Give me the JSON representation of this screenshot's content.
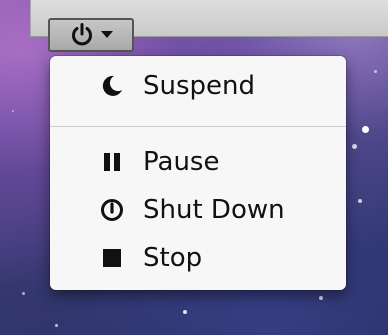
{
  "toolbar": {
    "power_button": {
      "icon": "power-icon",
      "dropdown_icon": "chevron-down-icon"
    }
  },
  "menu": {
    "items": [
      {
        "label": "Suspend",
        "icon": "moon-icon"
      },
      {
        "label": "Pause",
        "icon": "pause-icon"
      },
      {
        "label": "Shut Down",
        "icon": "shutdown-icon"
      },
      {
        "label": "Stop",
        "icon": "stop-icon"
      }
    ]
  }
}
